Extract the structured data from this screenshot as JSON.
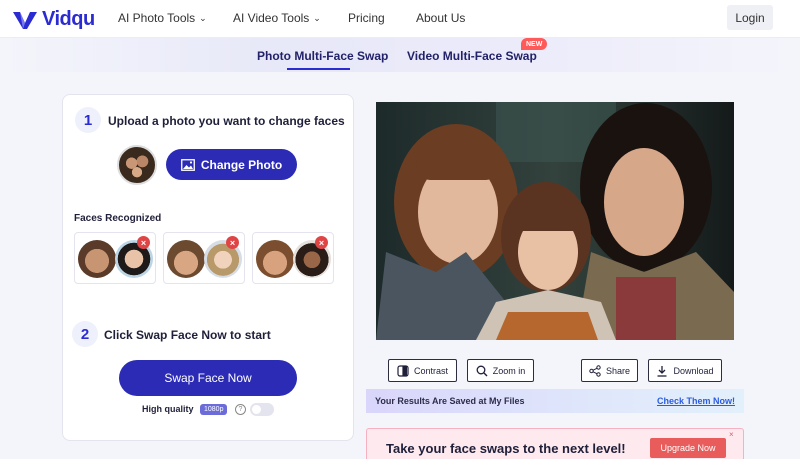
{
  "brand": {
    "name": "Vidqu",
    "color": "#2b2bd2"
  },
  "nav": {
    "items": [
      {
        "label": "AI Photo Tools",
        "has_dropdown": true
      },
      {
        "label": "AI Video Tools",
        "has_dropdown": true
      },
      {
        "label": "Pricing",
        "has_dropdown": false
      },
      {
        "label": "About Us",
        "has_dropdown": false
      }
    ],
    "login_label": "Login"
  },
  "tabs": {
    "items": [
      {
        "label": "Photo Multi-Face Swap",
        "active": true
      },
      {
        "label": "Video Multi-Face Swap",
        "active": false,
        "badge": "NEW"
      }
    ]
  },
  "upload": {
    "step": "1",
    "title": "Upload a photo you want to change faces",
    "change_label": "Change Photo",
    "faces_label": "Faces Recognized",
    "remove_glyph": "×"
  },
  "swap": {
    "step": "2",
    "title": "Click Swap Face Now to start",
    "button_label": "Swap Face Now",
    "quality_label": "High quality",
    "quality_badge": "1080p",
    "help_glyph": "?",
    "toggle_on": false
  },
  "tools": {
    "contrast": "Contrast",
    "zoom": "Zoom in",
    "share": "Share",
    "download": "Download"
  },
  "saved_bar": {
    "text": "Your Results Are Saved at My Files",
    "link": "Check Them Now!"
  },
  "promo": {
    "text": "Take your face swaps to the next level!",
    "button": "Upgrade Now",
    "close": "×"
  },
  "colors": {
    "primary_button": "#2b2bb5",
    "danger": "#e04545",
    "upgrade": "#e85c5c",
    "link": "#2b5be0"
  }
}
